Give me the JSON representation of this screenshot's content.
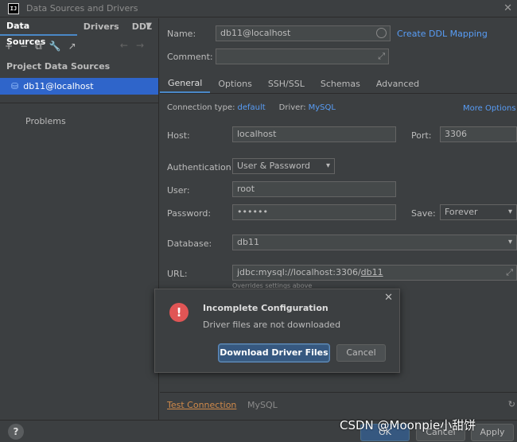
{
  "window": {
    "app_icon": "IJ",
    "title": "Data Sources and Drivers",
    "close_icon": "close-icon"
  },
  "left": {
    "tabs": [
      "Data Sources",
      "Drivers",
      "DDL"
    ],
    "toolbar": [
      "+",
      "−",
      "⧉",
      "🔧",
      "↗"
    ],
    "section_title": "Project Data Sources",
    "datasource": "db11@localhost",
    "problems": "Problems"
  },
  "form": {
    "name_label": "Name:",
    "name_value": "db11@localhost",
    "create_ddl": "Create DDL Mapping",
    "comment_label": "Comment:",
    "comment_value": "",
    "tabs": [
      "General",
      "Options",
      "SSH/SSL",
      "Schemas",
      "Advanced"
    ],
    "conn_type_label": "Connection type:",
    "conn_type_value": "default",
    "driver_label": "Driver:",
    "driver_value": "MySQL",
    "more_options": "More Options",
    "host_label": "Host:",
    "host_value": "localhost",
    "port_label": "Port:",
    "port_value": "3306",
    "auth_label": "Authentication:",
    "auth_value": "User & Password",
    "user_label": "User:",
    "user_value": "root",
    "password_label": "Password:",
    "password_value": "••••••",
    "save_label": "Save:",
    "save_value": "Forever",
    "database_label": "Database:",
    "database_value": "db11",
    "url_label": "URL:",
    "url_prefix": "jdbc:mysql://localhost:3306/",
    "url_db": "db11",
    "overrides_note": "Overrides settings above",
    "test_connection": "Test Connection",
    "driver_name": "MySQL"
  },
  "dialog": {
    "title": "Incomplete Configuration",
    "message": "Driver files are not downloaded",
    "primary_button": "Download Driver Files",
    "secondary_button": "Cancel"
  },
  "footer": {
    "help": "?",
    "ok": "OK",
    "cancel": "Cancel",
    "apply": "Apply"
  },
  "watermark": "CSDN @Moonpie小甜饼"
}
